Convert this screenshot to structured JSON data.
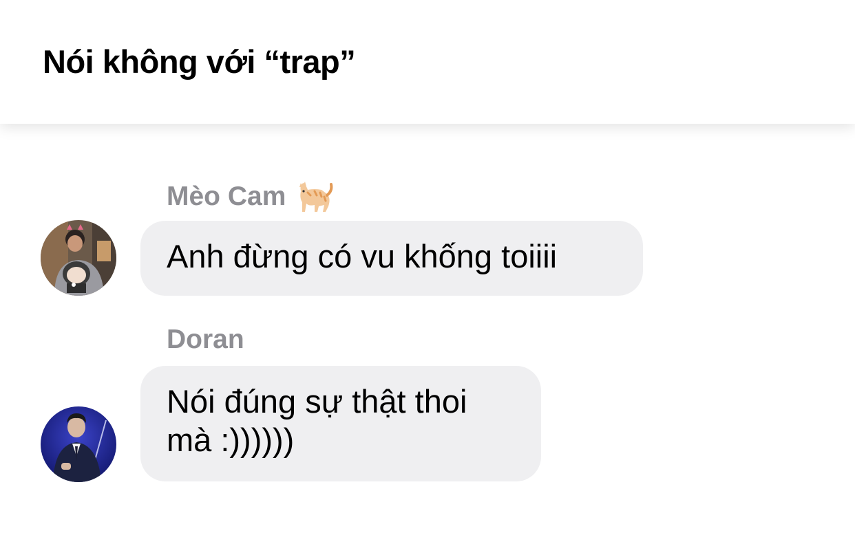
{
  "header": {
    "title": "Nói không với “trap”"
  },
  "messages": [
    {
      "sender": "Mèo Cam",
      "sender_emoji": "cat-emoji",
      "text": "Anh đừng có vu khống toiiii"
    },
    {
      "sender": "Doran",
      "text_line1": "Nói đúng sự thật thoi",
      "text_line2": "mà :))))))"
    }
  ],
  "colors": {
    "bubble_bg": "#efeff1",
    "sender_name": "#8e8e93",
    "title": "#000000"
  }
}
